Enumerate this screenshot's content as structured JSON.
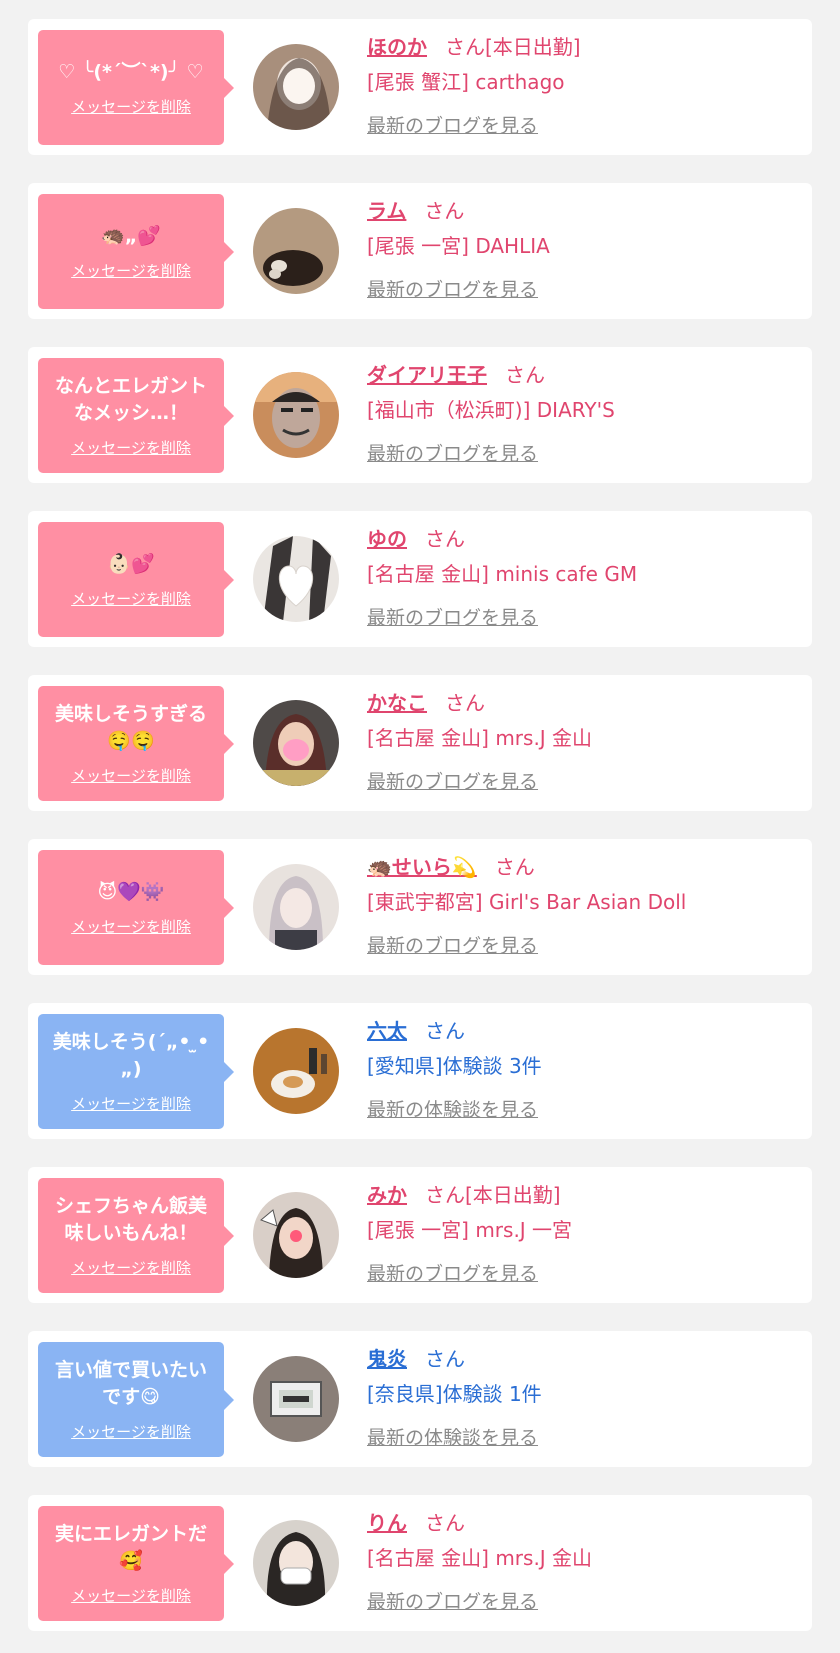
{
  "common": {
    "delete_label": "メッセージを削除",
    "honorific": "さん"
  },
  "colors": {
    "pink_bubble": "#ff8fa3",
    "blue_bubble": "#8ab4f3",
    "pink_text": "#e0456e",
    "blue_text": "#2a6ed4",
    "link_gray": "#8a8a8a"
  },
  "cards": [
    {
      "type": "cast",
      "message": "♡ ╰(*´︶`*)╯ ♡",
      "name": "ほのか",
      "badge": "[本日出勤]",
      "shop": "[尾張 蟹江] carthago",
      "link": "最新のブログを見る",
      "avatar_icon": "photo-woman-blurred"
    },
    {
      "type": "cast",
      "message": "🦔„💕",
      "name": "ラム",
      "badge": "",
      "shop": "[尾張 一宮] DAHLIA",
      "link": "最新のブログを見る",
      "avatar_icon": "photo-hair-back"
    },
    {
      "type": "cast",
      "message": "なんとエレガントなメッシ…！",
      "name": "ダイアリ王子",
      "badge": "",
      "shop": "[福山市（松浜町)] DIARY'S",
      "link": "最新のブログを見る",
      "avatar_icon": "photo-man-face"
    },
    {
      "type": "cast",
      "message": "👶🏻💕",
      "name": "ゆの",
      "badge": "",
      "shop": "[名古屋 金山] minis cafe GM",
      "link": "最新のブログを見る",
      "avatar_icon": "photo-heart-mask"
    },
    {
      "type": "cast",
      "message": "美味しそうすぎる🤤🤤",
      "name": "かなこ",
      "badge": "",
      "shop": "[名古屋 金山] mrs.J 金山",
      "link": "最新のブログを見る",
      "avatar_icon": "photo-woman-masked"
    },
    {
      "type": "cast",
      "message": "😈💜👾",
      "name": "🦔せいら💫",
      "badge": "",
      "shop": "[東武宇都宮] Girl's Bar Asian Doll",
      "link": "最新のブログを見る",
      "avatar_icon": "photo-woman-peace"
    },
    {
      "type": "user",
      "message": "美味しそう(´„• ̫•„)",
      "name": "六太",
      "badge": "",
      "shop": "[愛知県]体験談 3件",
      "link": "最新の体験談を見る",
      "avatar_icon": "photo-food-plate"
    },
    {
      "type": "cast",
      "message": "シェフちゃん飯美味しいもんね！",
      "name": "みか",
      "badge": "[本日出勤]",
      "shop": "[尾張 一宮] mrs.J 一宮",
      "link": "最新のブログを見る",
      "avatar_icon": "photo-woman-cat-filter"
    },
    {
      "type": "user",
      "message": "言い値で買いたいです😋",
      "name": "鬼炎",
      "badge": "",
      "shop": "[奈良県]体験談 1件",
      "link": "最新の体験談を見る",
      "avatar_icon": "photo-clock-display"
    },
    {
      "type": "cast",
      "message": "実にエレガントだ🥰",
      "name": "りん",
      "badge": "",
      "shop": "[名古屋 金山] mrs.J 金山",
      "link": "最新のブログを見る",
      "avatar_icon": "photo-woman-mask"
    }
  ]
}
